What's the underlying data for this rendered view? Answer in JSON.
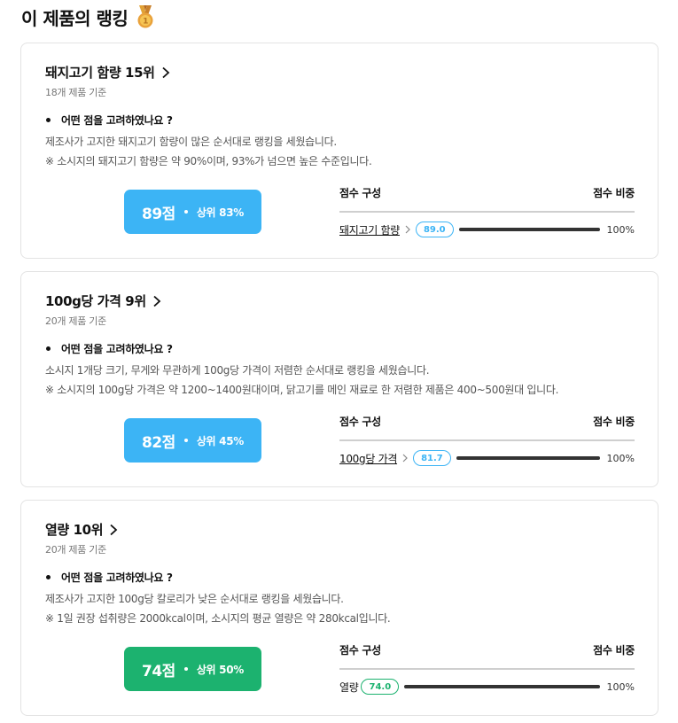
{
  "page": {
    "title": "이 제품의 랭킹",
    "icon": "medal-icon"
  },
  "cards": [
    {
      "title": "돼지고기 함량 15위",
      "subtitle": "18개 제품 기준",
      "question": "어떤 점을 고려하였나요 ?",
      "desc1": "제조사가 고지한 돼지고기 함량이 많은 순서대로 랭킹을 세웠습니다.",
      "desc2": "※ 소시지의 돼지고기 함량은 약 90%이며, 93%가 넘으면 높은 수준입니다.",
      "score": "89점",
      "rank": "상위 83%",
      "color": "#3cb4f5",
      "comp_header": "점수 구성",
      "weight_header": "점수 비중",
      "comp_name": "돼지고기 함량",
      "comp_value": "89.0",
      "comp_pct": "100%",
      "comp_fraction": 1.0
    },
    {
      "title": "100g당 가격 9위",
      "subtitle": "20개 제품 기준",
      "question": "어떤 점을 고려하였나요 ?",
      "desc1": "소시지 1개당 크기, 무게와 무관하게 100g당 가격이 저렴한 순서대로 랭킹을 세웠습니다.",
      "desc2": "※ 소시지의 100g당 가격은 약 1200~1400원대이며, 닭고기를 메인 재료로 한 저렴한 제품은 400~500원대 입니다.",
      "score": "82점",
      "rank": "상위 45%",
      "color": "#3cb4f5",
      "comp_header": "점수 구성",
      "weight_header": "점수 비중",
      "comp_name": "100g당 가격",
      "comp_value": "81.7",
      "comp_pct": "100%",
      "comp_fraction": 1.0
    },
    {
      "title": "열량 10위",
      "subtitle": "20개 제품 기준",
      "question": "어떤 점을 고려하였나요 ?",
      "desc1": "제조사가 고지한 100g당 칼로리가 낮은 순서대로 랭킹을 세웠습니다.",
      "desc2": "※ 1일 권장 섭취량은 2000kcal이며, 소시지의 평균 열량은 약 280kcal입니다.",
      "score": "74점",
      "rank": "상위 50%",
      "color": "#1cb26f",
      "comp_header": "점수 구성",
      "weight_header": "점수 비중",
      "comp_name": "열량",
      "comp_value": "74.0",
      "comp_pct": "100%",
      "comp_fraction": 1.0
    }
  ]
}
